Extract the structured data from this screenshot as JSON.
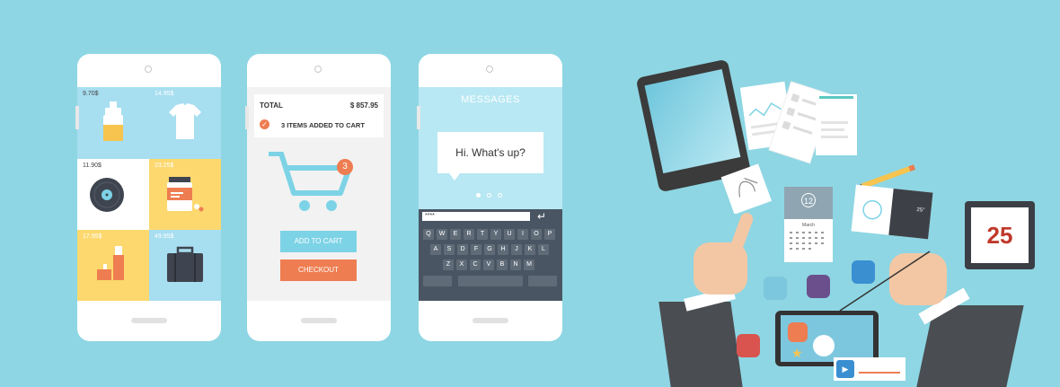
{
  "shop": {
    "products": [
      {
        "price": "9.70$",
        "icon": "soap-bottle-icon"
      },
      {
        "price": "14.95$",
        "icon": "tshirt-icon"
      },
      {
        "price": "11.90$",
        "icon": "vinyl-record-icon"
      },
      {
        "price": "23.25$",
        "icon": "jar-icon"
      },
      {
        "price": "17.95$",
        "icon": "usb-drive-icon"
      },
      {
        "price": "49.95$",
        "icon": "briefcase-icon"
      }
    ]
  },
  "cart": {
    "total_label": "TOTAL",
    "total_value": "$ 857.95",
    "items_added": "3 ITEMS ADDED TO CART",
    "badge_count": "3",
    "add_to_cart_label": "ADD TO CART",
    "checkout_label": "CHECKOUT"
  },
  "messages": {
    "title": "MESSAGES",
    "bubble_text": "Hi. What's up?",
    "input_value": "****",
    "keyboard_rows": [
      [
        "Q",
        "W",
        "E",
        "R",
        "T",
        "Y",
        "U",
        "I",
        "O",
        "P"
      ],
      [
        "A",
        "S",
        "D",
        "F",
        "G",
        "H",
        "J",
        "K",
        "L"
      ],
      [
        "Z",
        "X",
        "C",
        "V",
        "B",
        "N",
        "M"
      ]
    ]
  },
  "scene": {
    "calendar_small_day": "12",
    "calendar_small_month": "March",
    "calendar_big_day": "25",
    "weather_temp": "25°"
  },
  "colors": {
    "background": "#8ed6e3",
    "accent_orange": "#ee7d51",
    "accent_blue": "#7dd3e6"
  }
}
